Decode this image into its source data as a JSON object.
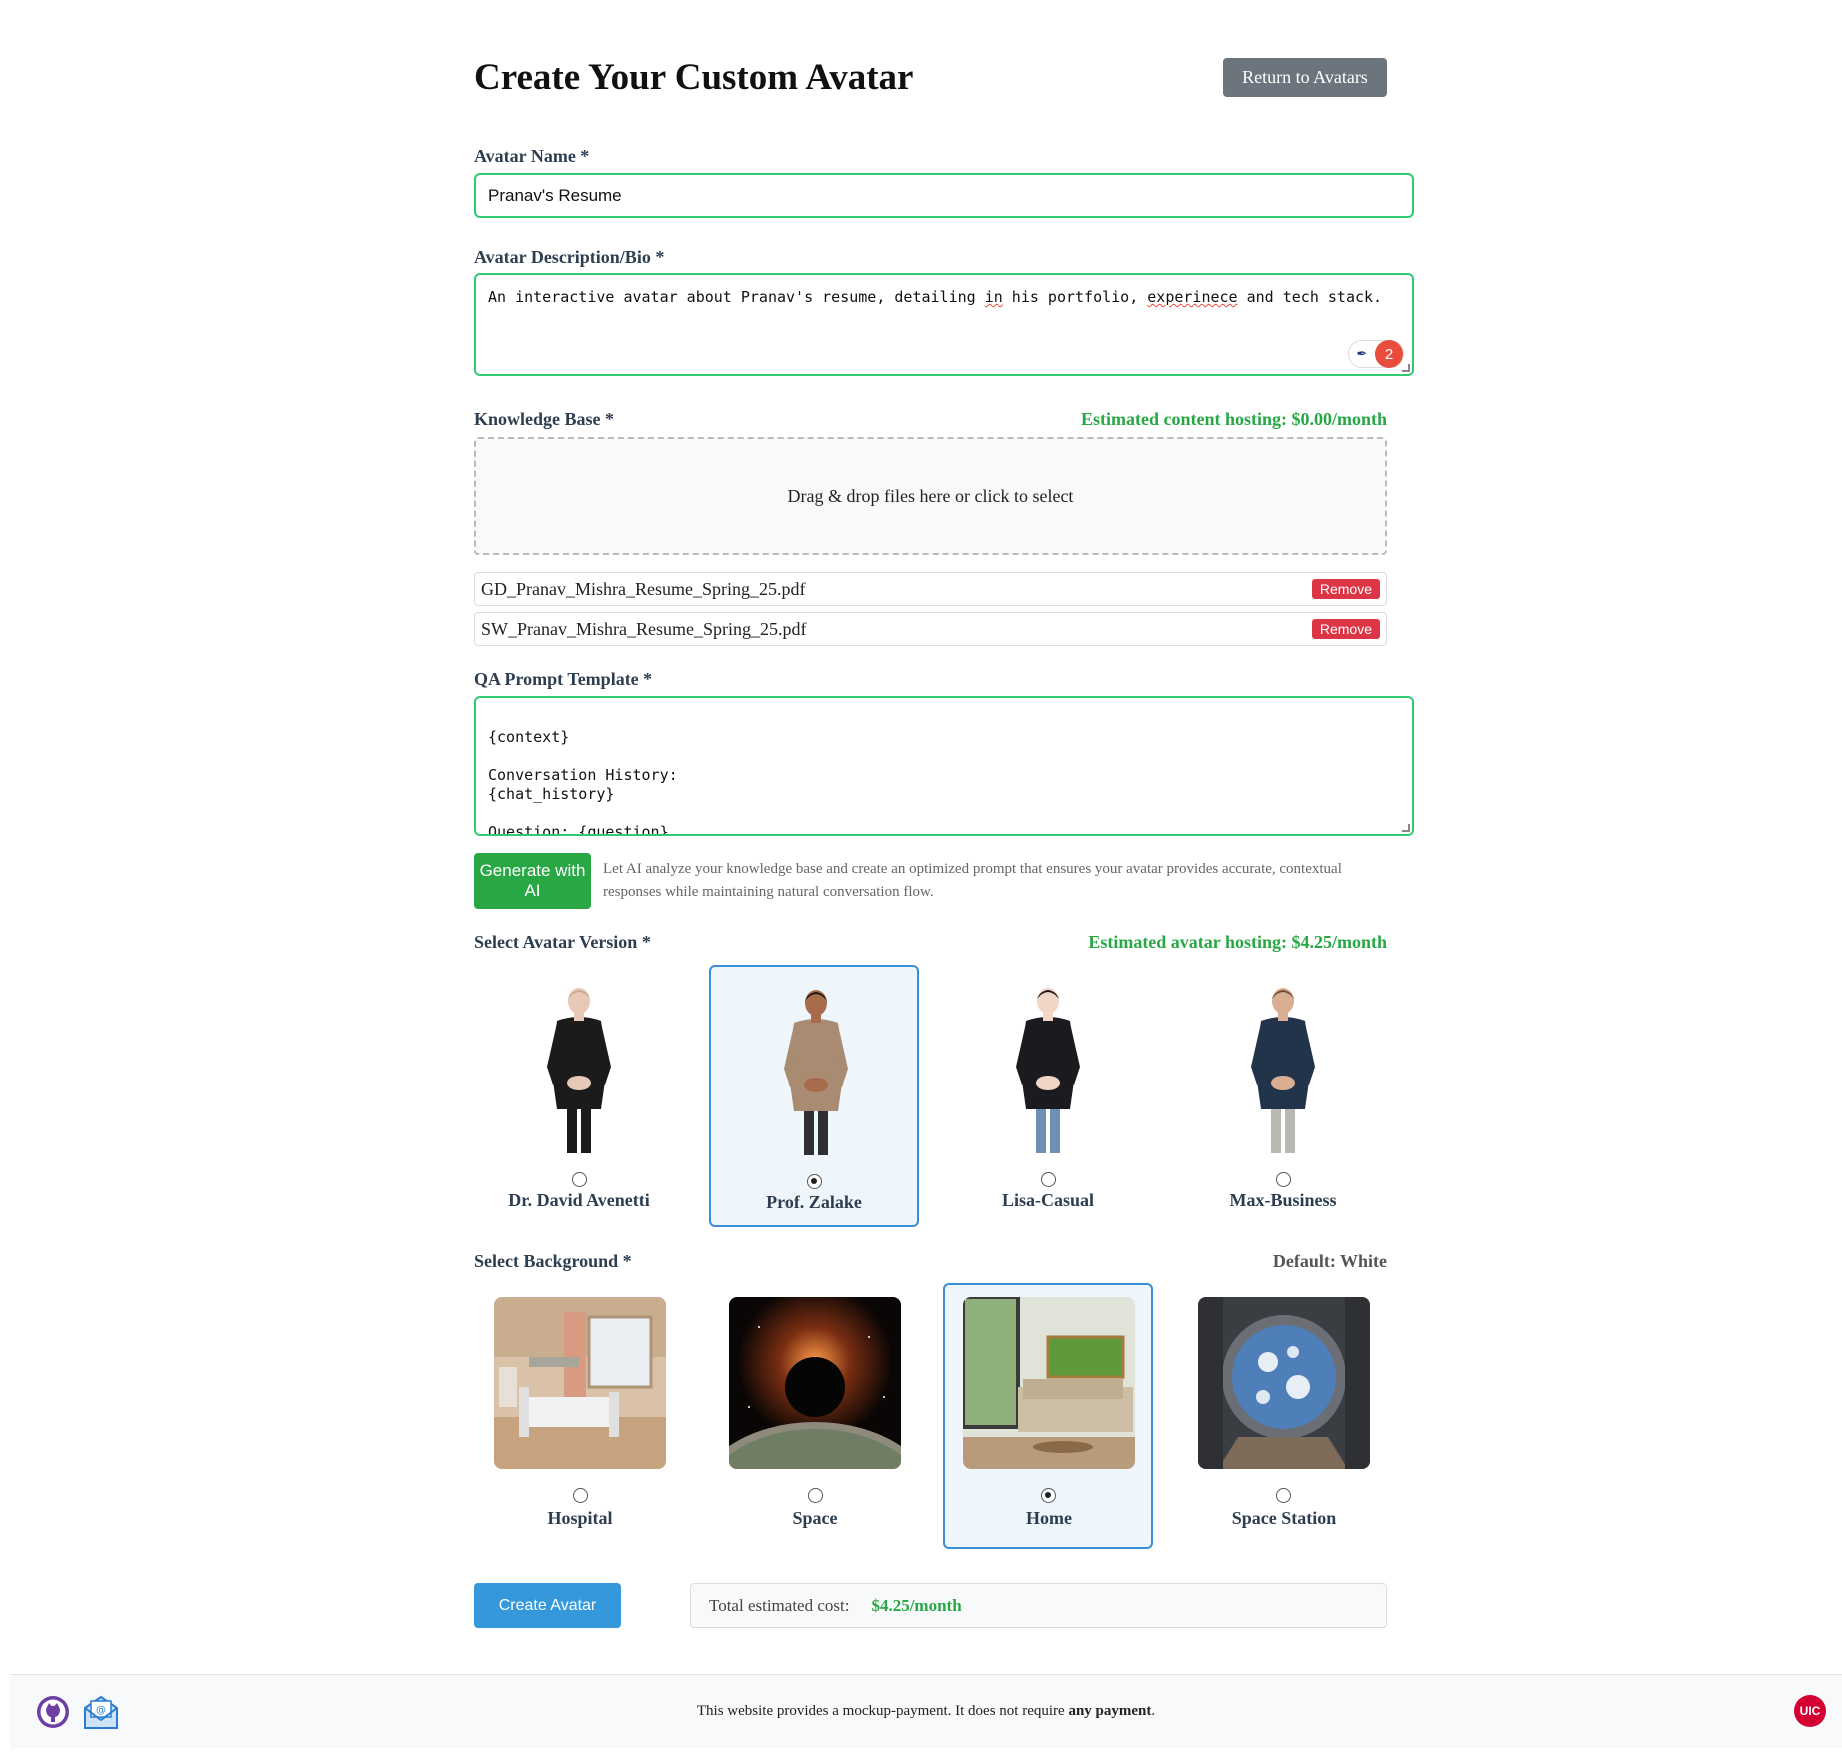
{
  "header": {
    "title": "Create Your Custom Avatar",
    "return_label": "Return to Avatars"
  },
  "name_field": {
    "label": "Avatar Name *",
    "value": "Pranav's Resume"
  },
  "bio_field": {
    "label": "Avatar Description/Bio *",
    "text_a": "An interactive avatar about Pranav's resume, detailing ",
    "text_b": "in",
    "text_c": " his portfolio, ",
    "text_d": "experinece",
    "text_e": " and tech stack.",
    "grammar_count": "2"
  },
  "knowledge": {
    "label": "Knowledge Base *",
    "hosting": "Estimated content hosting: $0.00/month",
    "dropzone": "Drag & drop files here or click to select",
    "files": [
      {
        "name": "GD_Pranav_Mishra_Resume_Spring_25.pdf",
        "remove": "Remove"
      },
      {
        "name": "SW_Pranav_Mishra_Resume_Spring_25.pdf",
        "remove": "Remove"
      }
    ]
  },
  "qa": {
    "label": "QA Prompt Template *",
    "value": "{context}\n\nConversation History:\n{chat_history}\n\nQuestion: {question}\nAvatar's Response:",
    "generate_label": "Generate with AI",
    "generate_desc": "Let AI analyze your knowledge base and create an optimized prompt that ensures your avatar provides accurate, contextual responses while maintaining natural conversation flow."
  },
  "versions": {
    "label": "Select Avatar Version *",
    "hosting": "Estimated avatar hosting: $4.25/month",
    "items": [
      {
        "name": "Dr. David Avenetti",
        "selected": false,
        "shirt": "#1b1b1b",
        "pants": "#1b1b1b",
        "skin": "#e8c9b8",
        "hair": "#c9a891"
      },
      {
        "name": "Prof. Zalake",
        "selected": true,
        "shirt": "#a88b70",
        "pants": "#2f2f33",
        "skin": "#a66c4c",
        "hair": "#1c1410"
      },
      {
        "name": "Lisa-Casual",
        "selected": false,
        "shirt": "#1a1a1f",
        "pants": "#6f8fb5",
        "skin": "#f1d6c6",
        "hair": "#1a1210"
      },
      {
        "name": "Max-Business",
        "selected": false,
        "shirt": "#22344a",
        "pants": "#b9b8b3",
        "skin": "#d9ae92",
        "hair": "#6b4a33"
      }
    ]
  },
  "backgrounds": {
    "label": "Select Background *",
    "default_note": "Default: White",
    "items": [
      {
        "name": "Hospital",
        "selected": false
      },
      {
        "name": "Space",
        "selected": false
      },
      {
        "name": "Home",
        "selected": true
      },
      {
        "name": "Space Station",
        "selected": false
      }
    ]
  },
  "actions": {
    "create_label": "Create Avatar",
    "total_label": "Total estimated cost:",
    "total_value": "$4.25/month"
  },
  "footer": {
    "text_a": "This website provides a mockup-payment. It does not require ",
    "text_b": "any payment",
    "text_c": ".",
    "logo": "UIC"
  }
}
